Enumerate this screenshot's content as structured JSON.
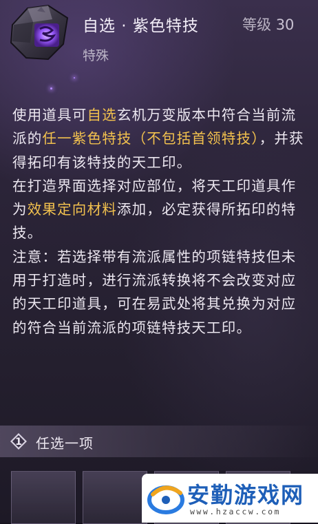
{
  "item": {
    "title": "自选 · 紫色特技",
    "level_label": "等级",
    "level_value": "30",
    "category": "特殊"
  },
  "description": {
    "p1": [
      {
        "text": "使用道具可",
        "highlight": false
      },
      {
        "text": "自选",
        "highlight": true
      },
      {
        "text": "玄机万变版本中符合当前流派的",
        "highlight": false
      },
      {
        "text": "任一紫色特技（不包括首领特技）",
        "highlight": true
      },
      {
        "text": "，并获得拓印有该特技的天工印。",
        "highlight": false
      }
    ],
    "p2": [
      {
        "text": "在打造界面选择对应部位，将天工印道具作为",
        "highlight": false
      },
      {
        "text": "效果定向材料",
        "highlight": true
      },
      {
        "text": "添加，必定获得所拓印的特技。",
        "highlight": false
      }
    ],
    "p3": "注意：若选择带有流派属性的项链特技但未用于打造时，进行流派转换将不会改变对应的天工印道具，可在易武处将其兑换为对应的符合当前流派的项链特技天工印。"
  },
  "choice": {
    "number": "1",
    "label": "任选一项"
  },
  "watermark": {
    "name": "安勤游戏网",
    "url": "www.hzaccw.com"
  },
  "colors": {
    "highlight": "#f2c14e",
    "text": "#ece7f0",
    "watermark_blue": "#1e5fb8"
  }
}
